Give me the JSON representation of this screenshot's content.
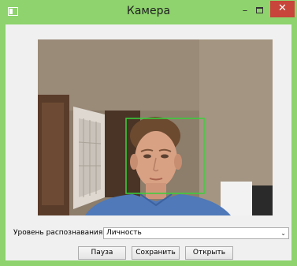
{
  "window": {
    "title": "Камера",
    "minimize_glyph": "–",
    "close_glyph": "✕"
  },
  "controls": {
    "recognition_label": "Уровень распознавания:",
    "recognition_value": "Личность",
    "dropdown_glyph": "⌄"
  },
  "buttons": {
    "pause": "Пауза",
    "save": "Сохранить",
    "open": "Открыть"
  },
  "colors": {
    "titlebar": "#8ed36d",
    "close_button": "#c7453a",
    "face_box": "#39d13a"
  }
}
